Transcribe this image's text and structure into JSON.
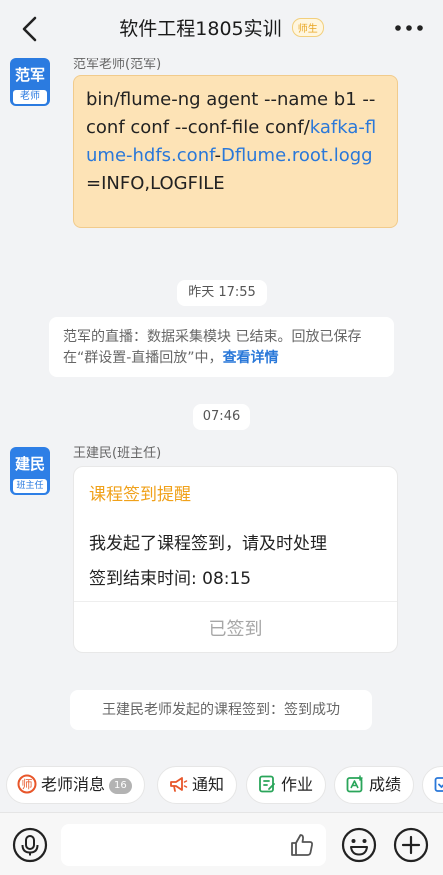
{
  "header": {
    "title": "软件工程1805实训",
    "role_badge": "师生",
    "back_icon": "chevron-left-icon",
    "more_icon": "more-dots-icon"
  },
  "messages": {
    "msg1": {
      "avatar_name": "范军",
      "avatar_role": "老师",
      "sender": "范军老师(范军)",
      "code_text_1": "bin/flume-ng agent --name b1 --conf conf --conf-file conf/",
      "code_link_1": "kafka-flume-hdfs.conf",
      "code_dash": "-",
      "code_link_2": "Dflume.root.logg",
      "code_text_2": "=INFO,LOGFILE"
    },
    "time1": "昨天 17:55",
    "live_notice": {
      "text": "范军的直播：数据采集模块 已结束。回放已保存在“群设置-直播回放”中，",
      "link": "查看详情"
    },
    "time2": "07:46",
    "msg2": {
      "avatar_name": "建民",
      "avatar_role": "班主任",
      "sender": "王建民(班主任)",
      "card_title": "课程签到提醒",
      "card_line1": "我发起了课程签到，请及时处理",
      "card_line2": "签到结束时间: 08:15",
      "card_button": "已签到"
    },
    "signin_notice": "王建民老师发起的课程签到：签到成功"
  },
  "quickbar": {
    "teacher_msg": "老师消息",
    "teacher_msg_count": "16",
    "notice": "通知",
    "homework": "作业",
    "grades": "成绩"
  },
  "input": {
    "placeholder": "",
    "voice_icon": "microphone-icon",
    "like_icon": "thumbs-up-icon",
    "emoji_icon": "emoji-icon",
    "plus_icon": "plus-icon"
  },
  "colors": {
    "accent_blue": "#2a78d9",
    "avatar_blue": "#2b7be0",
    "code_bubble": "#fde3b6",
    "card_title": "#f0a11a",
    "chip_red": "#e8562a",
    "chip_green": "#2aa55a"
  }
}
